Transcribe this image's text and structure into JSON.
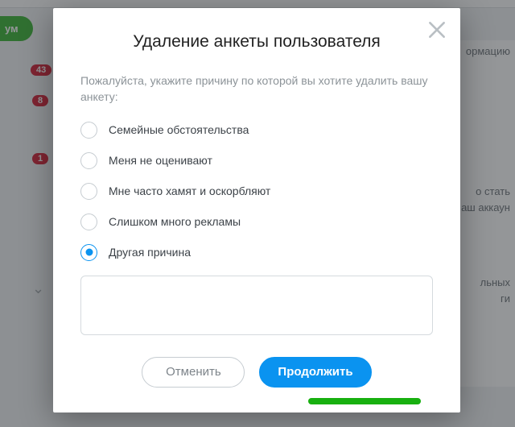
{
  "background": {
    "premium_pill": "ум",
    "badges": {
      "b1": "43",
      "b2": "8",
      "b3": "1"
    },
    "right_fragments": {
      "r1": "ормацию",
      "r2a": "о стать",
      "r2b": "аш аккаун",
      "r3a": "льных",
      "r3b": "ги"
    }
  },
  "modal": {
    "title": "Удаление анкеты пользователя",
    "prompt": "Пожалуйста, укажите причину по которой вы хотите удалить вашу анкету:",
    "options": [
      {
        "label": "Семейные обстоятельства",
        "selected": false
      },
      {
        "label": "Меня не оценивают",
        "selected": false
      },
      {
        "label": "Мне часто хамят и оскорбляют",
        "selected": false
      },
      {
        "label": "Слишком много рекламы",
        "selected": false
      },
      {
        "label": "Другая причина",
        "selected": true
      }
    ],
    "textarea_value": "",
    "textarea_placeholder": "",
    "cancel_label": "Отменить",
    "continue_label": "Продолжить"
  }
}
